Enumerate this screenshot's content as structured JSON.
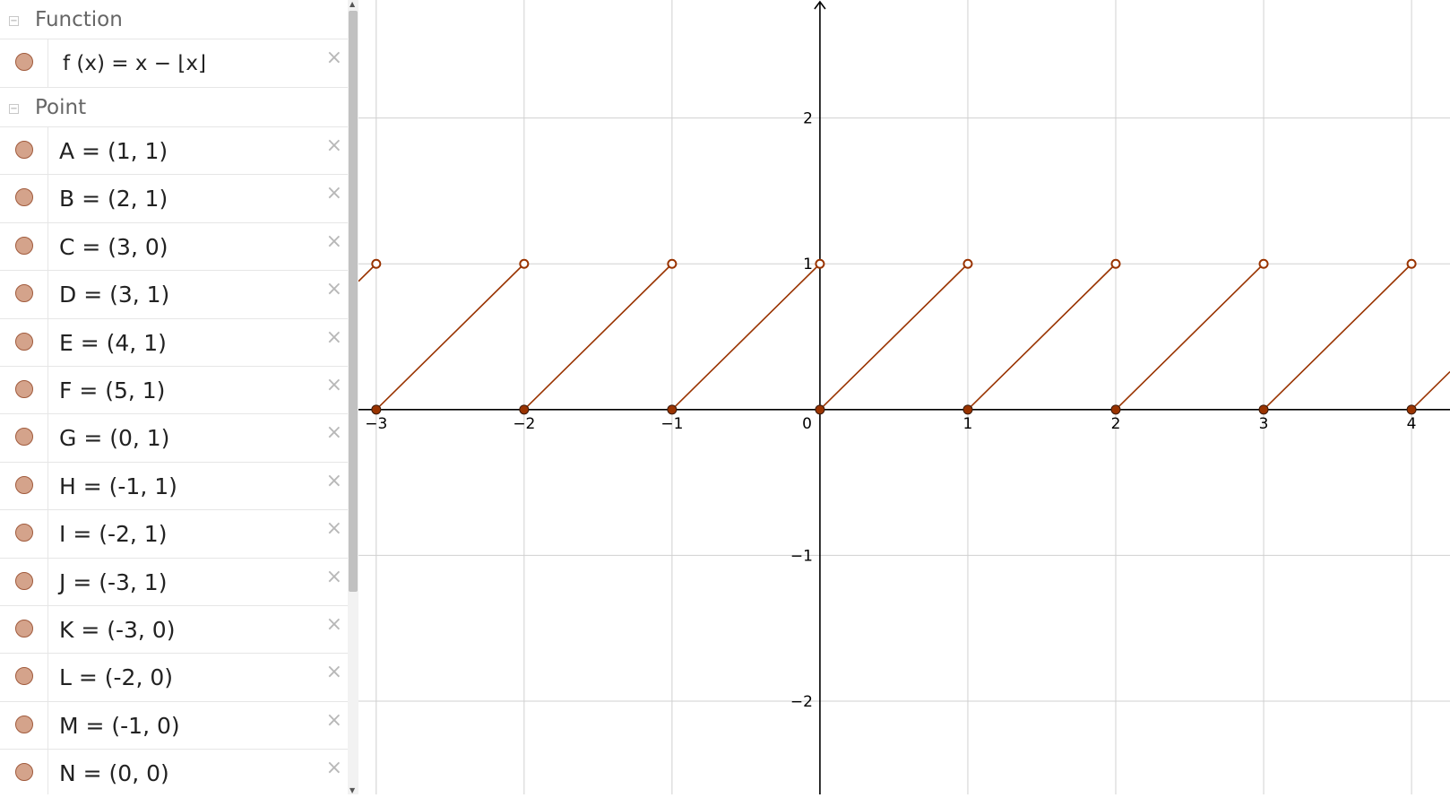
{
  "algebra": {
    "function_group": {
      "title": "Function",
      "items": [
        {
          "label": "f (x)  =  x − ⌊x⌋"
        }
      ]
    },
    "point_group": {
      "title": "Point",
      "items": [
        {
          "label": "A = (1, 1)"
        },
        {
          "label": "B = (2, 1)"
        },
        {
          "label": "C = (3, 0)"
        },
        {
          "label": "D = (3, 1)"
        },
        {
          "label": "E = (4, 1)"
        },
        {
          "label": "F = (5, 1)"
        },
        {
          "label": "G = (0, 1)"
        },
        {
          "label": "H = (-1, 1)"
        },
        {
          "label": "I = (-2, 1)"
        },
        {
          "label": "J = (-3, 1)"
        },
        {
          "label": "K = (-3, 0)"
        },
        {
          "label": "L = (-2, 0)"
        },
        {
          "label": "M = (-1, 0)"
        },
        {
          "label": "N = (0, 0)"
        }
      ]
    },
    "collapse_symbol": "−",
    "delete_symbol": "×"
  },
  "graph": {
    "x_ticks": [
      {
        "v": -3,
        "label": "−3"
      },
      {
        "v": -2,
        "label": "−2"
      },
      {
        "v": -1,
        "label": "−1"
      },
      {
        "v": 1,
        "label": "1"
      },
      {
        "v": 2,
        "label": "2"
      },
      {
        "v": 3,
        "label": "3"
      },
      {
        "v": 4,
        "label": "4"
      }
    ],
    "y_ticks": [
      {
        "v": 2,
        "label": "2"
      },
      {
        "v": 1,
        "label": "1"
      },
      {
        "v": -1,
        "label": "−1"
      },
      {
        "v": -2,
        "label": "−2"
      }
    ],
    "origin_label": "0",
    "xlim": [
      -3.12,
      4.26
    ],
    "ylim": [
      -2.64,
      2.81
    ],
    "function": "x - floor(x)",
    "closed_points": [
      [
        -3,
        0
      ],
      [
        -2,
        0
      ],
      [
        -1,
        0
      ],
      [
        0,
        0
      ],
      [
        1,
        0
      ],
      [
        2,
        0
      ],
      [
        3,
        0
      ],
      [
        4,
        0
      ]
    ],
    "open_points": [
      [
        -3,
        1
      ],
      [
        -2,
        1
      ],
      [
        -1,
        1
      ],
      [
        0,
        1
      ],
      [
        1,
        1
      ],
      [
        2,
        1
      ],
      [
        3,
        1
      ],
      [
        4,
        1
      ]
    ],
    "color": "#993300",
    "grid_color": "#d0d0d0",
    "axis_color": "#000000"
  }
}
